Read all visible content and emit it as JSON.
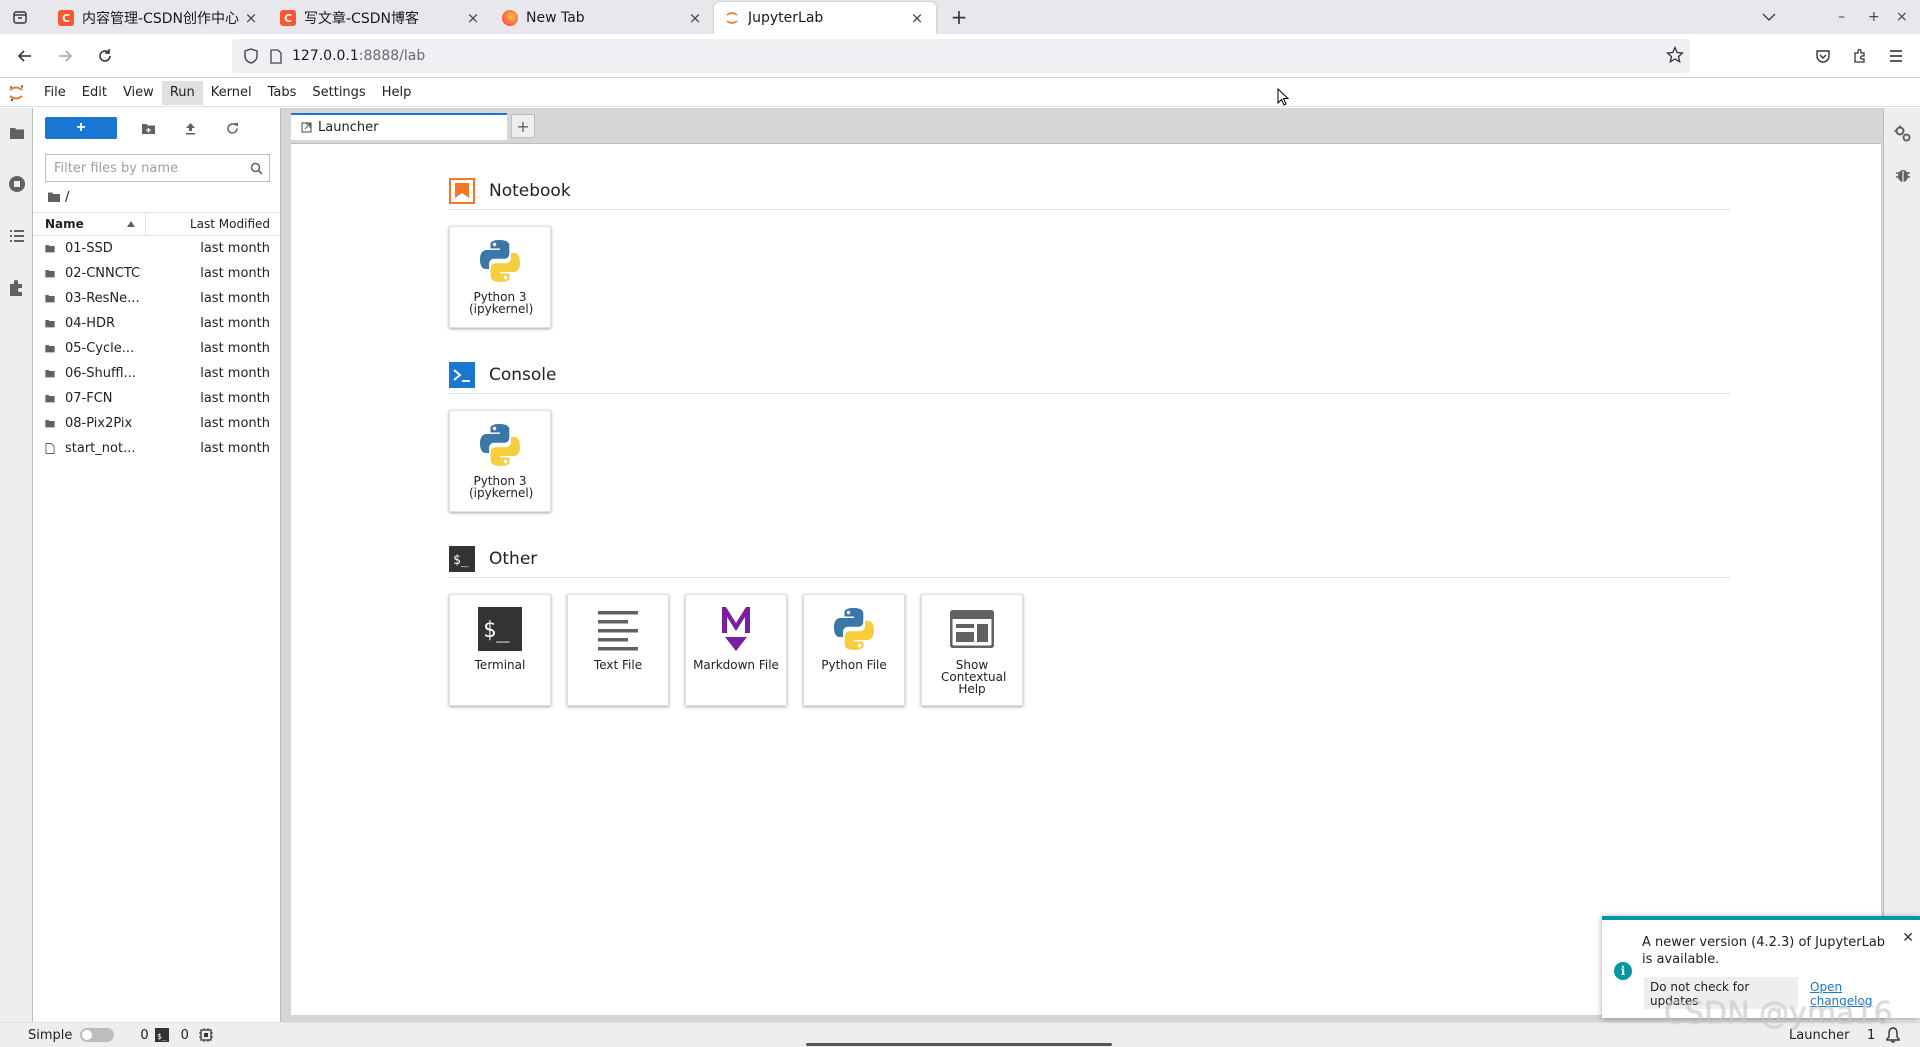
{
  "browser": {
    "tabs": [
      {
        "title": "内容管理-CSDN创作中心",
        "favicon": "csdn-icon",
        "color": "#fc5531",
        "active": false
      },
      {
        "title": "写文章-CSDN博客",
        "favicon": "csdn-icon",
        "color": "#fc5531",
        "active": false
      },
      {
        "title": "New Tab",
        "favicon": "firefox-icon",
        "color": "#ff7139",
        "active": false
      },
      {
        "title": "JupyterLab",
        "favicon": "jupyter-icon",
        "color": "#f37726",
        "active": true
      }
    ],
    "url_host": "127.0.0.1",
    "url_path": ":8888/lab"
  },
  "menubar": {
    "items": [
      "File",
      "Edit",
      "View",
      "Run",
      "Kernel",
      "Tabs",
      "Settings",
      "Help"
    ],
    "active": "Run"
  },
  "filebrowser": {
    "filter_placeholder": "Filter files by name",
    "crumb": "/",
    "col_name": "Name",
    "col_modified": "Last Modified",
    "files": [
      {
        "name": "01-SSD",
        "modified": "last month",
        "type": "folder"
      },
      {
        "name": "02-CNNCTC",
        "modified": "last month",
        "type": "folder"
      },
      {
        "name": "03-ResNe...",
        "modified": "last month",
        "type": "folder"
      },
      {
        "name": "04-HDR",
        "modified": "last month",
        "type": "folder"
      },
      {
        "name": "05-Cycle...",
        "modified": "last month",
        "type": "folder"
      },
      {
        "name": "06-Shuffl...",
        "modified": "last month",
        "type": "folder"
      },
      {
        "name": "07-FCN",
        "modified": "last month",
        "type": "folder"
      },
      {
        "name": "08-Pix2Pix",
        "modified": "last month",
        "type": "folder"
      },
      {
        "name": "start_not...",
        "modified": "last month",
        "type": "file"
      }
    ]
  },
  "main": {
    "tab_label": "Launcher",
    "sections": {
      "notebook": {
        "title": "Notebook",
        "cards": [
          {
            "label": "Python 3 (ipykernel)",
            "icon": "python-icon"
          }
        ]
      },
      "console": {
        "title": "Console",
        "cards": [
          {
            "label": "Python 3 (ipykernel)",
            "icon": "python-icon"
          }
        ]
      },
      "other": {
        "title": "Other",
        "cards": [
          {
            "label": "Terminal",
            "icon": "terminal-icon"
          },
          {
            "label": "Text File",
            "icon": "text-file-icon"
          },
          {
            "label": "Markdown File",
            "icon": "markdown-icon"
          },
          {
            "label": "Python File",
            "icon": "python-icon"
          },
          {
            "label": "Show Contextual Help",
            "icon": "contextual-help-icon"
          }
        ]
      }
    }
  },
  "statusbar": {
    "mode_label": "Simple",
    "terminals": "0",
    "kernels": "0",
    "right_label": "Launcher",
    "right_count": "1"
  },
  "notification": {
    "message": "A newer version (4.2.3) of JupyterLab is available.",
    "button_dismiss": "Do not check for updates",
    "button_changelog": "Open changelog"
  },
  "watermark": "CSDN @yma16",
  "colors": {
    "accent": "#1976d2",
    "jupyter_orange": "#f37726",
    "info": "#0097a7"
  }
}
